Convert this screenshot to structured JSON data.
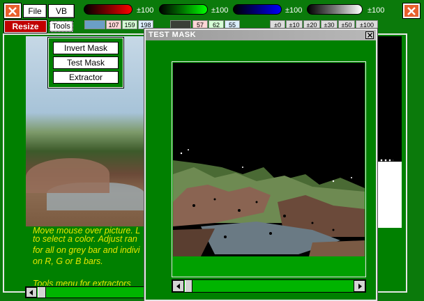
{
  "toolbar": {
    "file_label": "File",
    "vb_label": "VB",
    "resize_label": "Resize",
    "tools_label": "Tools",
    "red_pm": "±100",
    "green_pm": "±100",
    "blue_pm": "±100",
    "grey_pm": "±100",
    "rgb_values": [
      "107",
      "159",
      "198"
    ],
    "rgb_values_2": [
      "57",
      "62",
      "55"
    ],
    "grad_buttons": [
      "±0",
      "±10",
      "±20",
      "±30",
      "±50",
      "±100"
    ]
  },
  "colors": {
    "background": "#0b7a0b",
    "panel": "#008000",
    "close_orange": "#e8602c",
    "resize_red": "#c00000",
    "help_text": "#e7e700",
    "selected_swatch": "#6b9fc6"
  },
  "tools_menu": {
    "items": [
      "Invert Mask",
      "Test Mask",
      "Extractor"
    ]
  },
  "help": {
    "lines": [
      "Move mouse over picture. L",
      "to select a color.  Adjust ran",
      "for all on grey bar and indivi",
      "on R, G or B bars.",
      "",
      "Tools menu for extractors"
    ]
  },
  "dialog": {
    "title": "TEST MASK",
    "close_icon": "close-icon"
  },
  "icons": {
    "close": "close-icon",
    "left_arrow": "scroll-left-icon",
    "right_arrow": "scroll-right-icon"
  }
}
